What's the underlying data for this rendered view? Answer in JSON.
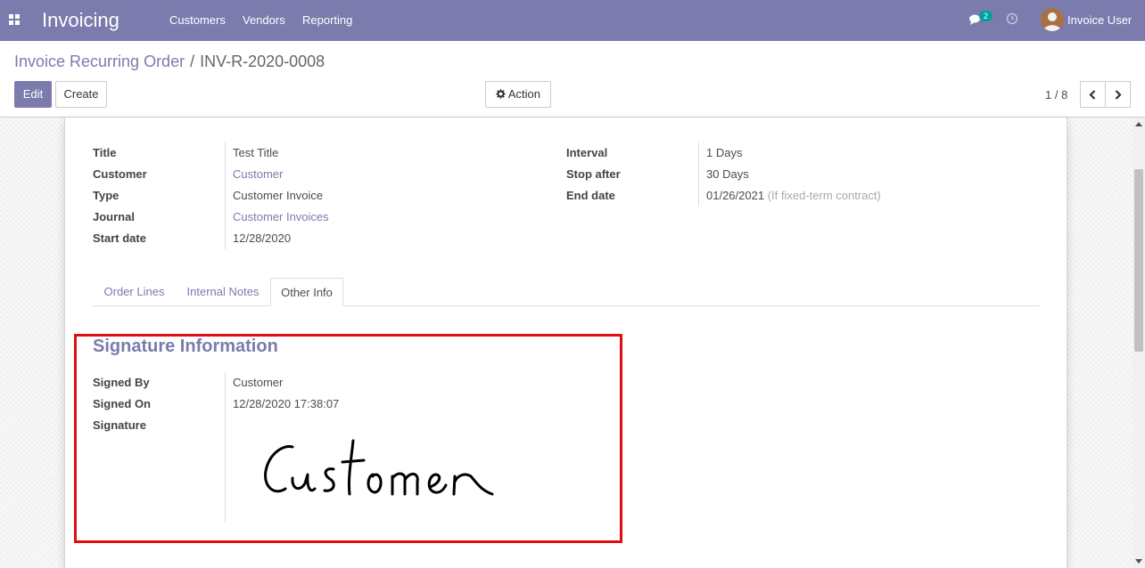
{
  "navbar": {
    "app_title": "Invoicing",
    "menu": [
      "Customers",
      "Vendors",
      "Reporting"
    ],
    "chat_count": "2",
    "user_name": "Invoice User",
    "bg_color": "#7c7bad"
  },
  "breadcrumb": {
    "parent": "Invoice Recurring Order",
    "separator": "/",
    "current": "INV-R-2020-0008"
  },
  "toolbar": {
    "edit_label": "Edit",
    "create_label": "Create",
    "action_label": "Action"
  },
  "pager": {
    "value": "1 / 8"
  },
  "form": {
    "left": [
      {
        "label": "Title",
        "value": "Test Title"
      },
      {
        "label": "Customer",
        "value": "Customer"
      },
      {
        "label": "Type",
        "value": "Customer Invoice"
      },
      {
        "label": "Journal",
        "value": "Customer Invoices"
      },
      {
        "label": "Start date",
        "value": "12/28/2020"
      }
    ],
    "right": [
      {
        "label": "Interval",
        "value": "1",
        "unit": "Days"
      },
      {
        "label": "Stop after",
        "value": "30",
        "unit": "Days"
      },
      {
        "label": "End date",
        "value": "01/26/2021",
        "hint": "(If fixed-term contract)"
      }
    ]
  },
  "tabs": [
    {
      "label": "Order Lines",
      "active": false
    },
    {
      "label": "Internal Notes",
      "active": false
    },
    {
      "label": "Other Info",
      "active": true
    }
  ],
  "signature_section": {
    "title": "Signature Information",
    "signed_by_label": "Signed By",
    "signed_by": "Customer",
    "signed_on_label": "Signed On",
    "signed_on": "12/28/2020 17:38:07",
    "signature_label": "Signature",
    "signature_text": "Customer"
  },
  "colors": {
    "accent": "#7c7bad",
    "highlight": "#e20c0c"
  }
}
